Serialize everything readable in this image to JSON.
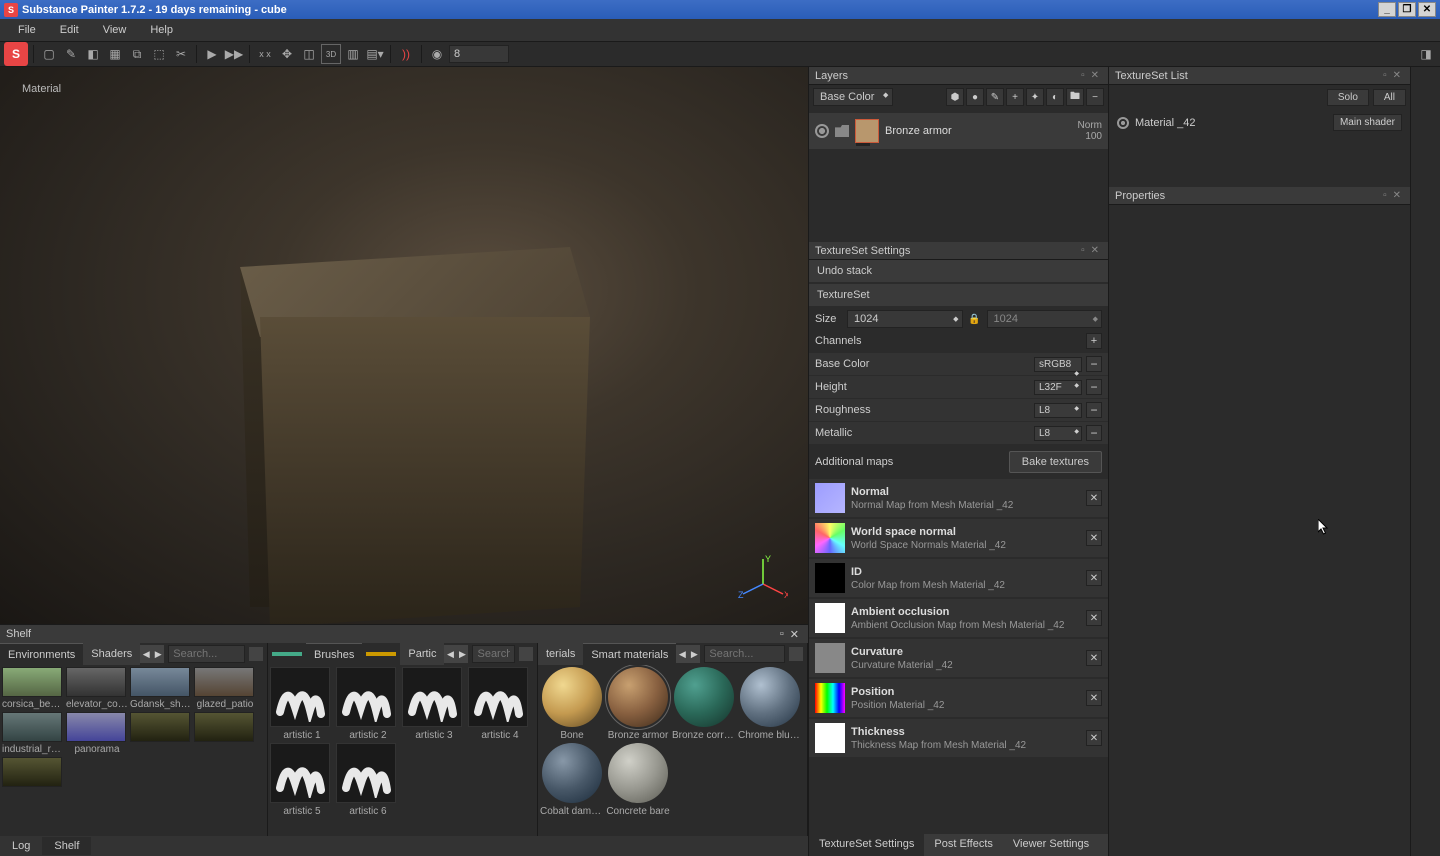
{
  "titlebar": {
    "title": "Substance Painter 1.7.2 - 19 days remaining - cube"
  },
  "menubar": {
    "items": [
      "File",
      "Edit",
      "View",
      "Help"
    ]
  },
  "toolbar": {
    "input_value": "8"
  },
  "viewport": {
    "label": "Material",
    "axis": {
      "x": "X",
      "y": "Y",
      "z": "Z"
    }
  },
  "layers": {
    "title": "Layers",
    "channel": "Base Color",
    "item": {
      "name": "Bronze armor",
      "blend": "Norm",
      "opacity": "100"
    }
  },
  "texset_settings": {
    "title": "TextureSet Settings",
    "undo": "Undo stack",
    "tslabel": "TextureSet",
    "size_label": "Size",
    "size1": "1024",
    "size2": "1024",
    "channels_label": "Channels",
    "channels": [
      {
        "name": "Base Color",
        "fmt": "sRGB8"
      },
      {
        "name": "Height",
        "fmt": "L32F"
      },
      {
        "name": "Roughness",
        "fmt": "L8"
      },
      {
        "name": "Metallic",
        "fmt": "L8"
      }
    ],
    "addmaps": "Additional maps",
    "bake": "Bake textures",
    "maps": [
      {
        "name": "Normal",
        "sub": "Normal Map from Mesh Material _42",
        "bg": "linear-gradient(135deg,#9d9dff,#b5b5ff)"
      },
      {
        "name": "World space normal",
        "sub": "World Space Normals Material _42",
        "bg": "conic-gradient(#ff6,#6f6,#6ff,#66f,#f6f,#f66,#ff6)"
      },
      {
        "name": "ID",
        "sub": "Color Map from Mesh Material _42",
        "bg": "#000"
      },
      {
        "name": "Ambient occlusion",
        "sub": "Ambient Occlusion Map from Mesh Material _42",
        "bg": "#fff"
      },
      {
        "name": "Curvature",
        "sub": "Curvature Material _42",
        "bg": "#888"
      },
      {
        "name": "Position",
        "sub": "Position Material _42",
        "bg": "linear-gradient(90deg,#f00,#ff0,#0f0,#0ff,#00f,#f0f)"
      },
      {
        "name": "Thickness",
        "sub": "Thickness Map from Mesh Material _42",
        "bg": "#fff"
      }
    ],
    "tabs": [
      "TextureSet Settings",
      "Post Effects",
      "Viewer Settings"
    ]
  },
  "tslist": {
    "title": "TextureSet List",
    "solo": "Solo",
    "all": "All",
    "item": {
      "name": "Material _42",
      "shader": "Main shader"
    }
  },
  "properties": {
    "title": "Properties"
  },
  "shelf": {
    "title": "Shelf",
    "tabs_env": [
      "Environments",
      "Shaders"
    ],
    "search_placeholder": "Search...",
    "brushes_tab": "Brushes",
    "particles_tab": "Partic",
    "materials_tab": "terials",
    "smart_tab": "Smart materials",
    "envs": [
      "corsica_beach",
      "elevator_corr...",
      "Gdansk_ship...",
      "glazed_patio",
      "industrial_room",
      "panorama"
    ],
    "brushes": [
      "artistic 1",
      "artistic 2",
      "artistic 3",
      "artistic 4",
      "artistic 5",
      "artistic 6"
    ],
    "materials": [
      "Bone",
      "Bronze armor",
      "Bronze corro...",
      "Chrome blue...",
      "Cobalt dama...",
      "Concrete bare"
    ],
    "mat_colors": [
      "radial-gradient(circle at 35% 30%, #f0d890, #c49a50 50%, #5a4420)",
      "radial-gradient(circle at 35% 30%, #c8a070, #886040 50%, #3a2818)",
      "radial-gradient(circle at 35% 30%, #50a090, #2a6858 50%, #143028)",
      "radial-gradient(circle at 35% 30%, #b0c0d0, #607080 50%, #203040)",
      "radial-gradient(circle at 35% 30%, #8898a8, #485868 50%, #182838)",
      "radial-gradient(circle at 35% 30%, #d0d0c8, #989890 50%, #585850)"
    ],
    "footer": [
      "Log",
      "Shelf"
    ]
  }
}
